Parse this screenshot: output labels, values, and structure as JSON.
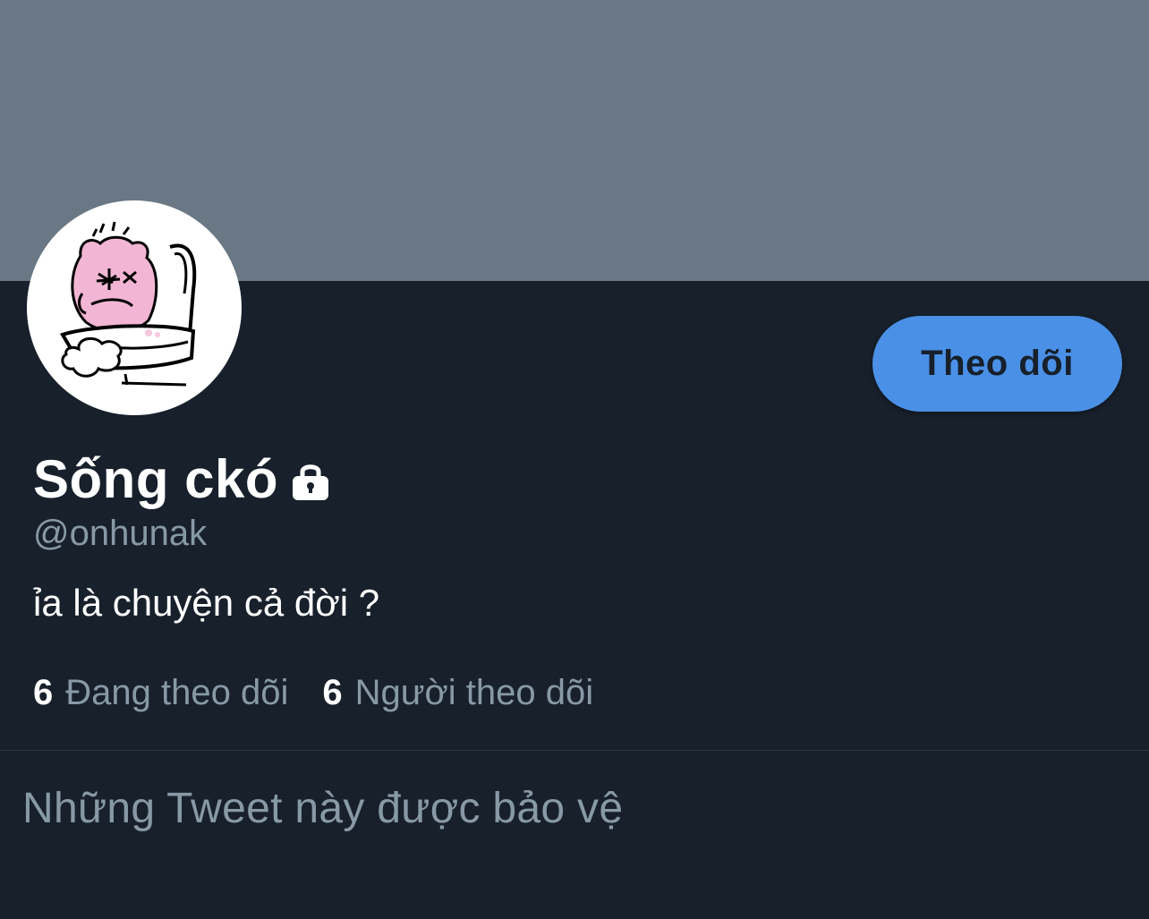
{
  "profile": {
    "display_name": "Sống ckó",
    "handle": "@onhunak",
    "bio": "ỉa là chuyện cả đời ?",
    "locked_icon": "lock-icon",
    "avatar_icon": "pink-hamster-avatar"
  },
  "actions": {
    "follow_label": "Theo dõi"
  },
  "stats": {
    "following_count": "6",
    "following_label": "Đang theo dõi",
    "followers_count": "6",
    "followers_label": "Người theo dõi"
  },
  "content": {
    "protected_message": "Những Tweet này được bảo vệ"
  },
  "colors": {
    "banner": "#6a7785",
    "background": "#17202b",
    "accent": "#4a90e6",
    "muted_text": "#8899a6",
    "text": "#ffffff"
  }
}
